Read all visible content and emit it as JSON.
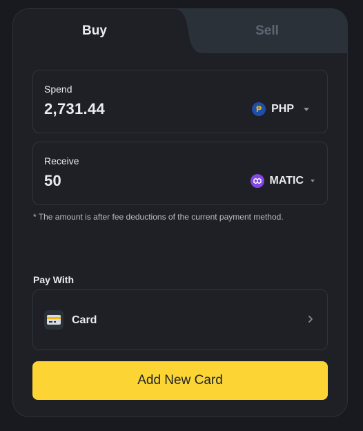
{
  "tabs": {
    "buy_label": "Buy",
    "sell_label": "Sell",
    "active": "Buy"
  },
  "spend": {
    "label": "Spend",
    "amount": "2,731.44",
    "currency": "PHP",
    "currency_icon": "peso-coin-icon"
  },
  "receive": {
    "label": "Receive",
    "amount": "50",
    "currency": "MATIC",
    "currency_icon": "polygon-matic-icon"
  },
  "note": "* The amount is after fee deductions of the current payment method.",
  "pay_with": {
    "label": "Pay With",
    "method_label": "Card",
    "method_icon": "credit-card-icon"
  },
  "add_card_button": "Add New Card",
  "colors": {
    "background": "#181a20",
    "panel": "#1e2026",
    "border": "#2f343c",
    "inactive_tab": "#2b3139",
    "accent": "#fcd535",
    "text_primary": "#eaecef",
    "text_muted": "#5e6673"
  }
}
